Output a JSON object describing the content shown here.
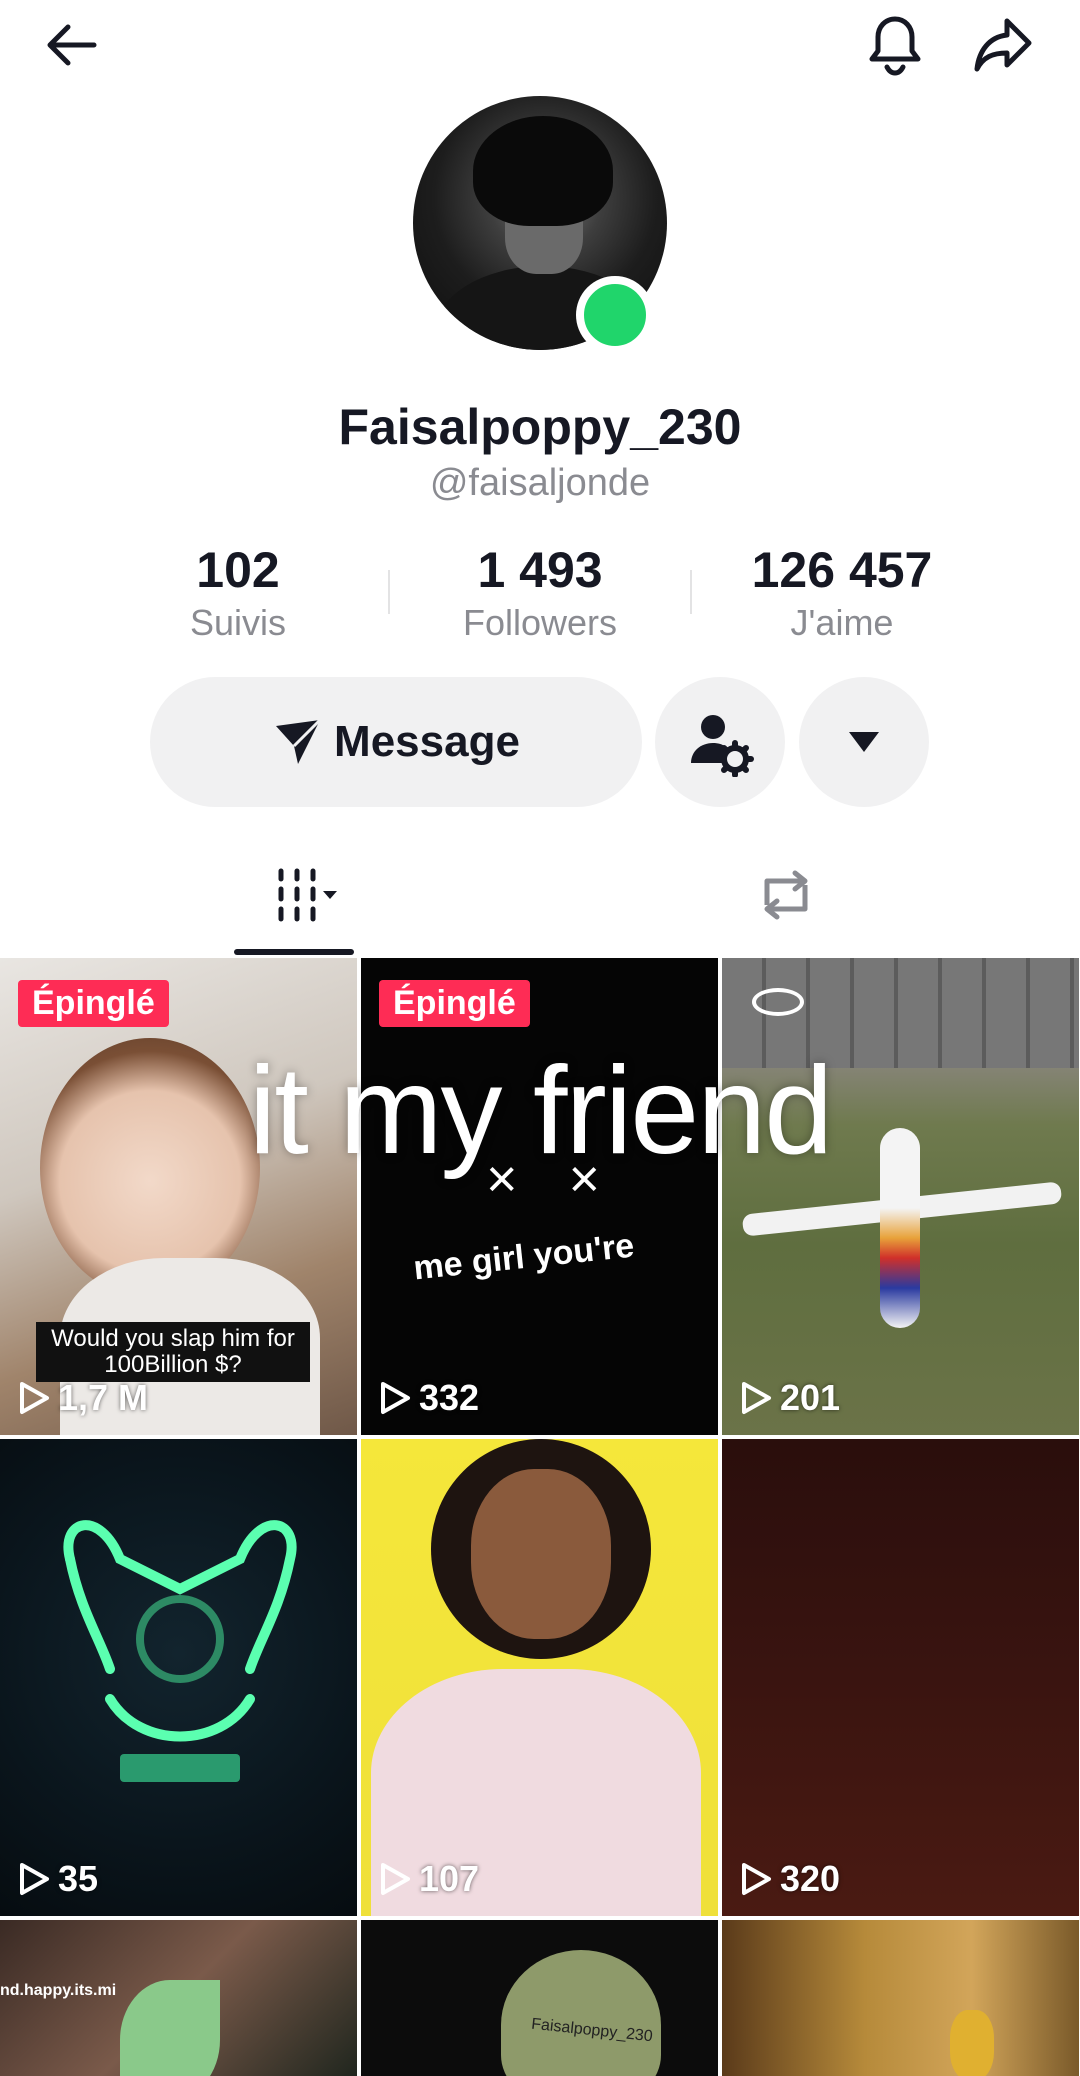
{
  "profile": {
    "display_name": "Faisalpoppy_230",
    "username": "@faisaljonde"
  },
  "stats": [
    {
      "value": "102",
      "label": "Suivis"
    },
    {
      "value": "1 493",
      "label": "Followers"
    },
    {
      "value": "126 457",
      "label": "J'aime"
    }
  ],
  "actions": {
    "message_label": "Message"
  },
  "overlay": {
    "text": "it my friend"
  },
  "videos": [
    {
      "pinned_label": "Épinglé",
      "views": "1,7 M",
      "caption": "Would you slap him for 100Billion $?"
    },
    {
      "pinned_label": "Épinglé",
      "views": "332",
      "caption": "me girl you're"
    },
    {
      "views": "201"
    },
    {
      "views": "35"
    },
    {
      "views": "107"
    },
    {
      "views": "320"
    },
    {
      "caption": "nd.happy.its.mi"
    },
    {
      "caption": "Faisalpoppy_230"
    },
    {}
  ],
  "colors": {
    "accent": "#fe2c55",
    "online": "#20d56b",
    "muted": "#8a8b91",
    "button_bg": "#f1f1f2"
  },
  "icons": [
    "back-arrow-icon",
    "bell-icon",
    "share-icon",
    "send-icon",
    "person-gear-icon",
    "caret-down-icon",
    "grid-icon",
    "repost-icon",
    "play-icon",
    "eye-icon"
  ]
}
